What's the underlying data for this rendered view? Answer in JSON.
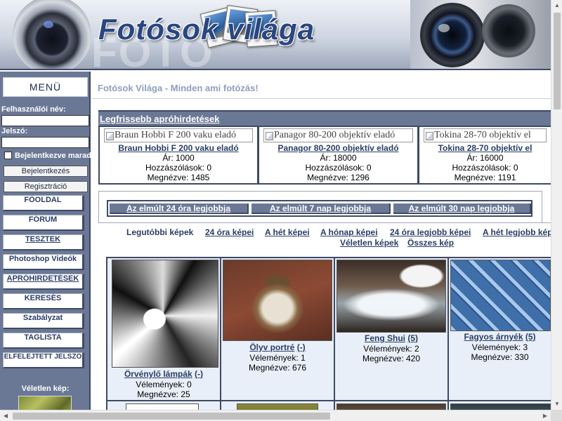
{
  "header": {
    "logo_text": "Fotósok világa"
  },
  "sidebar": {
    "menu_title": "MENÜ",
    "username_label": "Felhasználói név:",
    "username_value": "",
    "password_label": "Jelszó:",
    "password_value": "",
    "remember_label": "Bejelentkezve marad",
    "login_button": "Bejelentkezés",
    "register_button": "Regisztráció",
    "items": [
      {
        "label": "FŐOLDAL"
      },
      {
        "label": "FÓRUM"
      },
      {
        "label": "TESZTEK"
      },
      {
        "label": "Photoshop Videók"
      },
      {
        "label": "APRÓHIRDETÉSEK"
      },
      {
        "label": "KERESÉS"
      },
      {
        "label": "Szabályzat"
      },
      {
        "label": "TAGLISTA"
      },
      {
        "label": "ELFELEJTETT JELSZÓ"
      }
    ],
    "random_label": "Véletlen kép:"
  },
  "main": {
    "page_title": "Fotósok Világa - Minden ami fotózás!",
    "ads_title": "Legfrissebb apróhirdetések",
    "ads": [
      {
        "img_alt": "Braun Hobbi F 200 vaku eladó",
        "title": "Braun Hobbi F 200 vaku eladó",
        "price": "Ár: 1000",
        "comments": "Hozzászólások: 0",
        "views": "Megnézve: 1485"
      },
      {
        "img_alt": "Panagor 80-200 objektív eladó",
        "title": "Panagor 80-200 objektív eladó",
        "price": "Ár: 18000",
        "comments": "Hozzászólások: 0",
        "views": "Megnézve: 1296"
      },
      {
        "img_alt": "Tokina 28-70 objektív el",
        "title": "Tokina 28-70 objektív el",
        "price": "Ár: 16000",
        "comments": "Hozzászólások: 0",
        "views": "Megnézve: 1191"
      }
    ],
    "tabs": [
      {
        "label": "Az elmúlt 24 óra legjobbja"
      },
      {
        "label": "Az elmúlt 7 nap legjobbja"
      },
      {
        "label": "Az elmúlt 30 nap legjobbja"
      }
    ],
    "filters": [
      {
        "label": "Legutóbbi képek"
      },
      {
        "label": "24 óra képei"
      },
      {
        "label": "A hét képei"
      },
      {
        "label": "A hónap képei"
      },
      {
        "label": "24 óra legjobb képei"
      },
      {
        "label": "A hét legjobb kép"
      },
      {
        "label": "Véletlen képek"
      },
      {
        "label": "Összes kép"
      }
    ],
    "photos": [
      {
        "title": "Örvénylő lámpák",
        "count": "(-)",
        "opinions": "Vélemények: 0",
        "views": "Megnézve: 25"
      },
      {
        "title": "Ölyv portré",
        "count": "(-)",
        "opinions": "Vélemények: 1",
        "views": "Megnézve: 676"
      },
      {
        "title": "Feng Shui",
        "count": "(5)",
        "opinions": "Vélemények: 2",
        "views": "Megnézve: 420"
      },
      {
        "title": "Fagyos árnyék",
        "count": "(5)",
        "opinions": "Vélemények: 3",
        "views": "Megnézve: 330"
      }
    ]
  },
  "colors": {
    "sidebar_bg": "#6b7895",
    "dark_border": "#3d4a66",
    "link": "#2a3d66",
    "title": "#8e9fc0",
    "cell_bg": "#e9eff9"
  }
}
